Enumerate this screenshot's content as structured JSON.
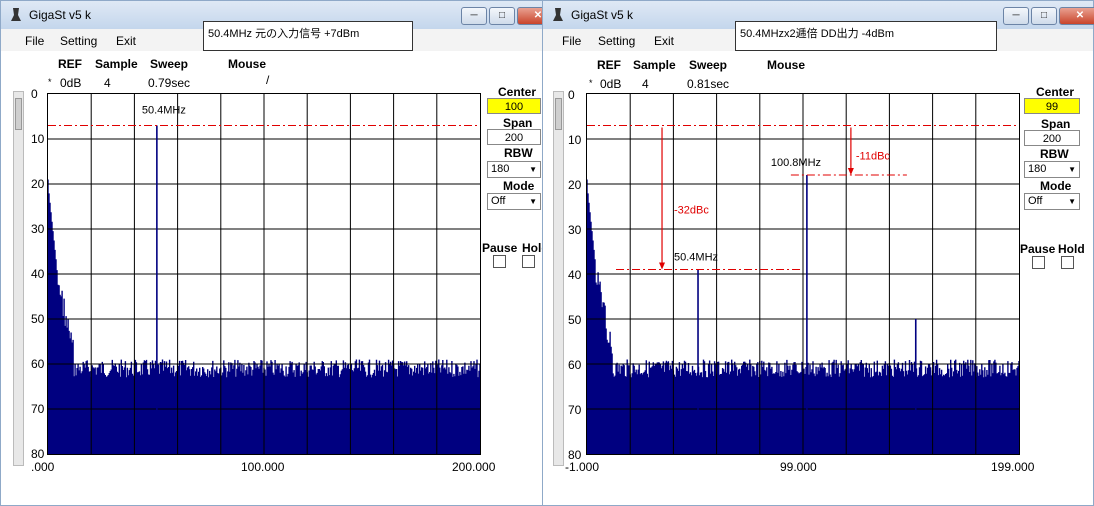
{
  "left": {
    "title": "GigaSt v5 k",
    "note": "50.4MHz  元の入力信号   +7dBm",
    "menu": [
      "File",
      "Setting",
      "Exit"
    ],
    "ref_label": "REF",
    "ref_value": "0dB",
    "sample_label": "Sample",
    "sample_value": "4",
    "sweep_label": "Sweep",
    "sweep_value": "0.79sec",
    "mouse_label": "Mouse",
    "y_ticks": [
      "0",
      "10",
      "20",
      "30",
      "40",
      "50",
      "60",
      "70",
      "80"
    ],
    "x_ticks": [
      ".000",
      "100.000",
      "200.000"
    ],
    "center_label": "Center",
    "center_value": "100",
    "span_label": "Span",
    "span_value": "200",
    "rbw_label": "RBW",
    "rbw_value": "180",
    "mode_label": "Mode",
    "mode_value": "Off",
    "pause_label": "Pause",
    "hold_label": "Hold",
    "peak_label": "50.4MHz"
  },
  "right": {
    "title": "GigaSt v5 k",
    "note": "50.4MHzx2逓倍  DD出力   -4dBm",
    "menu": [
      "File",
      "Setting",
      "Exit"
    ],
    "ref_label": "REF",
    "ref_value": "0dB",
    "sample_label": "Sample",
    "sample_value": "4",
    "sweep_label": "Sweep",
    "sweep_value": "0.81sec",
    "mouse_label": "Mouse",
    "y_ticks": [
      "0",
      "10",
      "20",
      "30",
      "40",
      "50",
      "60",
      "70",
      "80"
    ],
    "x_ticks": [
      "-1.000",
      "99.000",
      "199.000"
    ],
    "center_label": "Center",
    "center_value": "99",
    "span_label": "Span",
    "span_value": "200",
    "rbw_label": "RBW",
    "rbw_value": "180",
    "mode_label": "Mode",
    "mode_value": "Off",
    "pause_label": "Pause",
    "hold_label": "Hold",
    "peak1_label": "100.8MHz",
    "peak2_label": "50.4MHz",
    "ann1": "-11dBc",
    "ann2": "-32dBc"
  },
  "colors": {
    "trace": "#000080",
    "annotation": "#e00000",
    "center_box": "#ffff00"
  },
  "chart_data": [
    {
      "type": "area",
      "ylabel": "",
      "xlabel": "",
      "xlim": [
        0,
        200
      ],
      "ylim": [
        80,
        0
      ],
      "peaks": [
        {
          "x": 50.4,
          "y": 7,
          "label": "50.4MHz"
        }
      ],
      "reference_level": 7,
      "noise_floor": 61
    },
    {
      "type": "area",
      "ylabel": "",
      "xlabel": "",
      "xlim": [
        -1,
        199
      ],
      "ylim": [
        80,
        0
      ],
      "peaks": [
        {
          "x": 50.4,
          "y": 39,
          "label": "50.4MHz"
        },
        {
          "x": 100.8,
          "y": 18,
          "label": "100.8MHz"
        },
        {
          "x": 151.2,
          "y": 50
        }
      ],
      "reference_level": 7,
      "annotations": [
        {
          "text": "-11dBc"
        },
        {
          "text": "-32dBc"
        }
      ],
      "noise_floor": 61
    }
  ]
}
